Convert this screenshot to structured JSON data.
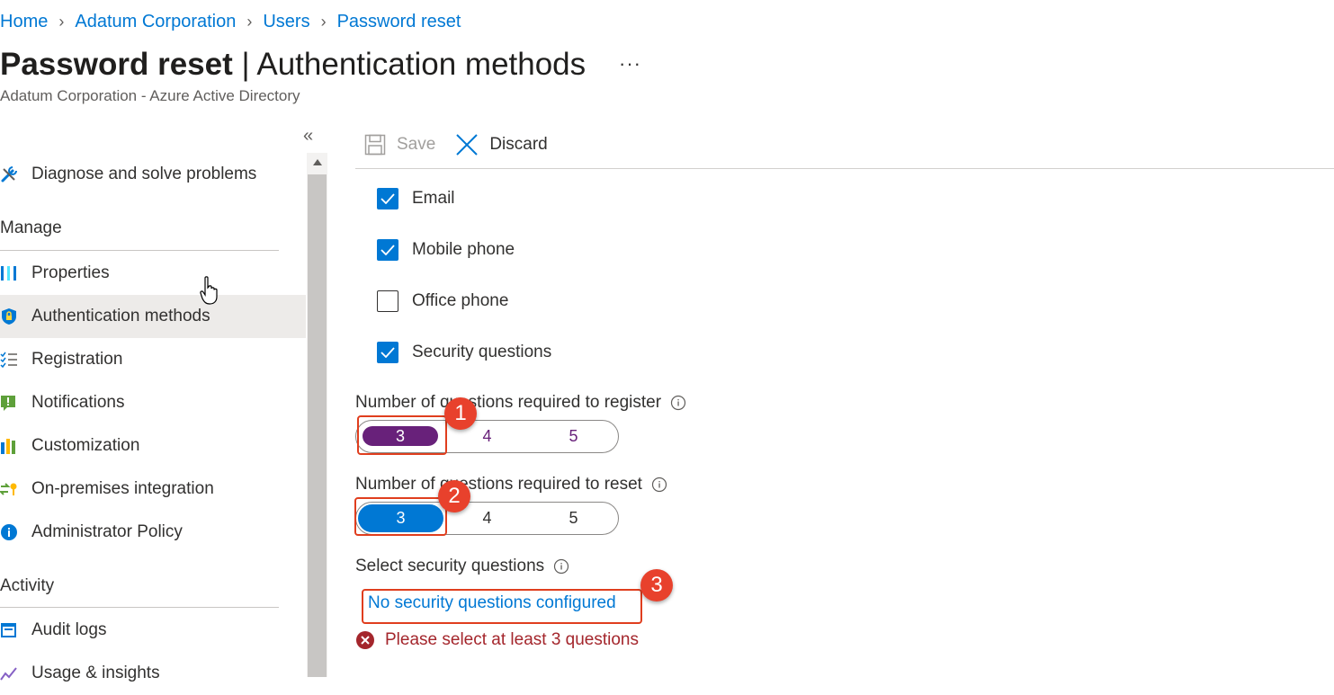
{
  "breadcrumb": [
    "Home",
    "Adatum Corporation",
    "Users",
    "Password reset"
  ],
  "header": {
    "title_bold": "Password reset",
    "title_rest": " | Authentication methods",
    "more": "···",
    "subtitle": "Adatum Corporation - Azure Active Directory"
  },
  "sidebar": {
    "collapse": "«",
    "items": [
      {
        "label": "Diagnose and solve problems",
        "icon": "wrench-icon"
      },
      {
        "label": "Properties",
        "icon": "properties-icon"
      },
      {
        "label": "Authentication methods",
        "icon": "shield-icon"
      },
      {
        "label": "Registration",
        "icon": "registration-list-icon"
      },
      {
        "label": "Notifications",
        "icon": "notification-icon"
      },
      {
        "label": "Customization",
        "icon": "customization-icon"
      },
      {
        "label": "On-premises integration",
        "icon": "on-premises-icon"
      },
      {
        "label": "Administrator Policy",
        "icon": "info-icon"
      },
      {
        "label": "Audit logs",
        "icon": "audit-logs-icon"
      },
      {
        "label": "Usage & insights",
        "icon": "usage-icon"
      }
    ],
    "sections": {
      "manage": "Manage",
      "activity": "Activity"
    },
    "selected": "Authentication methods"
  },
  "toolbar": {
    "save": "Save",
    "discard": "Discard"
  },
  "methods": [
    {
      "label": "Email",
      "checked": true
    },
    {
      "label": "Mobile phone",
      "checked": true
    },
    {
      "label": "Office phone",
      "checked": false
    },
    {
      "label": "Security questions",
      "checked": true
    }
  ],
  "register": {
    "label": "Number of questions required to register",
    "options": [
      "3",
      "4",
      "5"
    ],
    "selected": "3"
  },
  "reset": {
    "label": "Number of questions required to reset",
    "options": [
      "3",
      "4",
      "5"
    ],
    "selected": "3"
  },
  "security_questions": {
    "label": "Select security questions",
    "link": "No security questions configured",
    "error": "Please select at least 3 questions"
  },
  "annotations": [
    "1",
    "2",
    "3"
  ],
  "colors": {
    "accent": "#0078d4",
    "register_selected": "#68217a",
    "annotation": "#e03e1e",
    "error": "#a4262c"
  }
}
